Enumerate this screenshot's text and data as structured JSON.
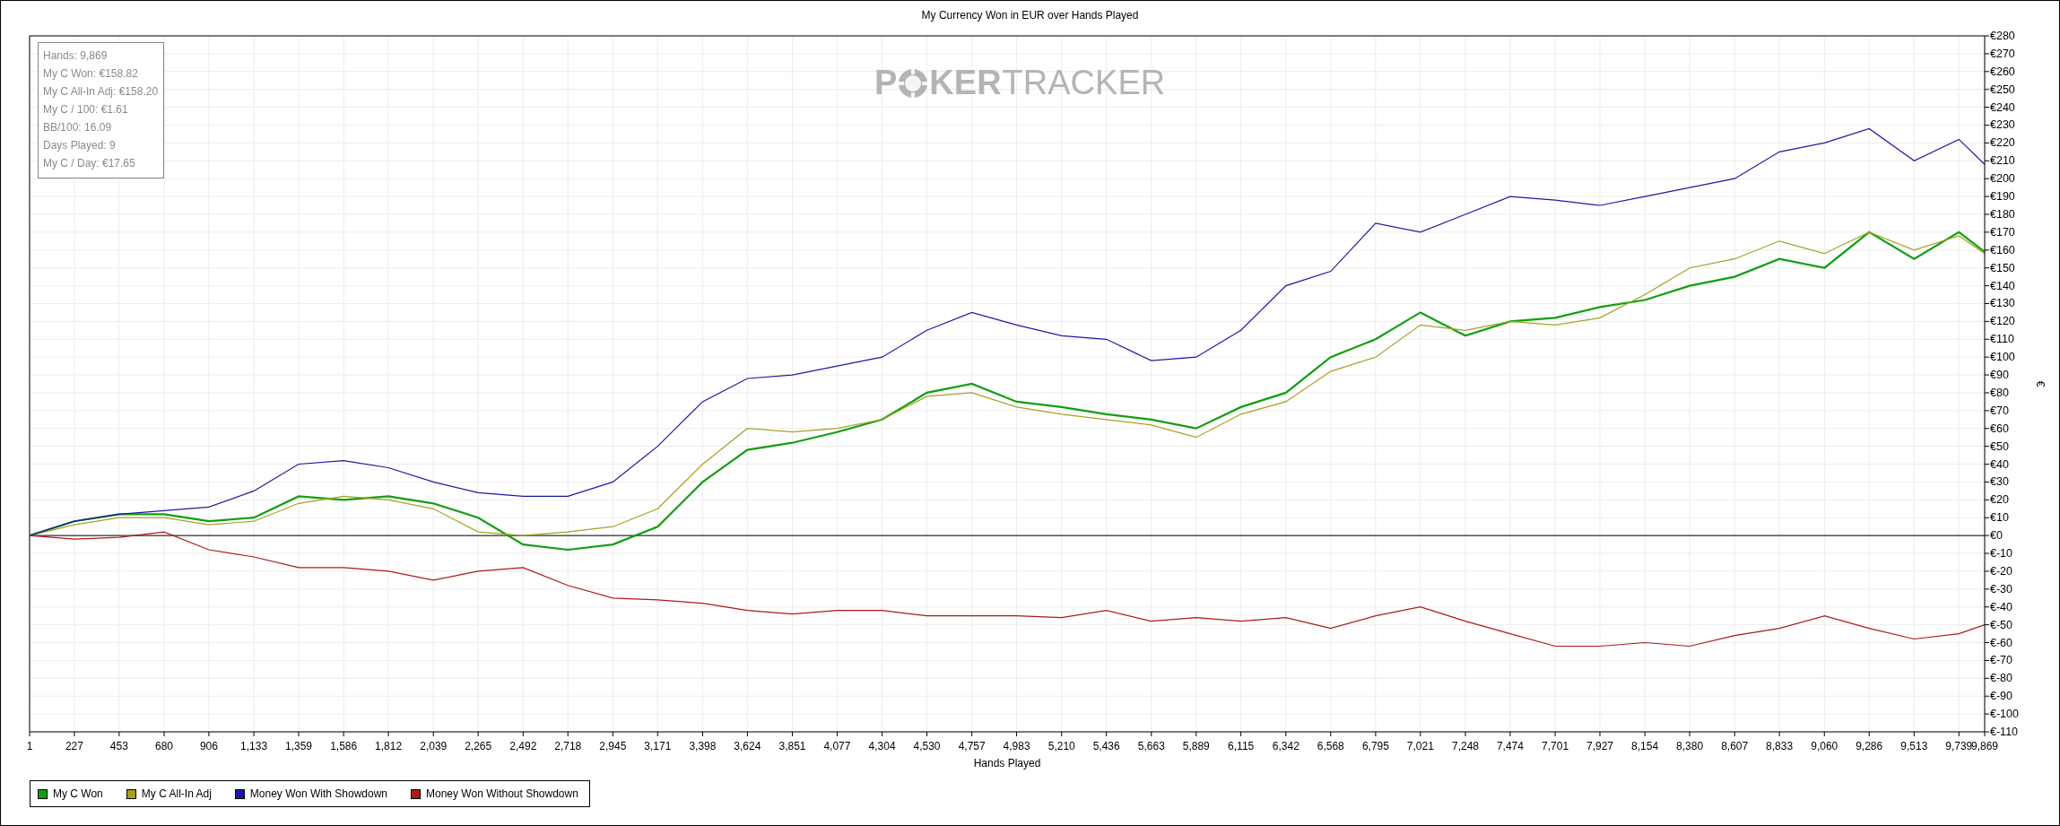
{
  "title": "My Currency Won in EUR over Hands Played",
  "stats_box": [
    "Hands: 9,869",
    "My C Won: €158.82",
    "My C All-In Adj: €158.20",
    "My C / 100: €1.61",
    "BB/100: 16.09",
    "Days Played: 9",
    "My C / Day: €17.65"
  ],
  "logo": {
    "first": "P",
    "middle": "KER",
    "last": "TRACKER"
  },
  "chart_data": {
    "type": "line",
    "xlabel": "Hands Played",
    "ylabel": "€",
    "ylim": [
      -110,
      280
    ],
    "xlim": [
      1,
      9869
    ],
    "grid": true,
    "x": [
      1,
      227,
      453,
      680,
      906,
      1133,
      1359,
      1586,
      1812,
      2039,
      2265,
      2492,
      2718,
      2945,
      3171,
      3398,
      3624,
      3851,
      4077,
      4304,
      4530,
      4757,
      4983,
      5210,
      5436,
      5663,
      5889,
      6115,
      6342,
      6568,
      6795,
      7021,
      7248,
      7474,
      7701,
      7927,
      8154,
      8380,
      8607,
      8833,
      9060,
      9286,
      9513,
      9739,
      9869
    ],
    "xticks": [
      {
        "value": 1,
        "label": "1"
      },
      {
        "value": 227,
        "label": "227"
      },
      {
        "value": 453,
        "label": "453"
      },
      {
        "value": 680,
        "label": "680"
      },
      {
        "value": 906,
        "label": "906"
      },
      {
        "value": 1133,
        "label": "1,133"
      },
      {
        "value": 1359,
        "label": "1,359"
      },
      {
        "value": 1586,
        "label": "1,586"
      },
      {
        "value": 1812,
        "label": "1,812"
      },
      {
        "value": 2039,
        "label": "2,039"
      },
      {
        "value": 2265,
        "label": "2,265"
      },
      {
        "value": 2492,
        "label": "2,492"
      },
      {
        "value": 2718,
        "label": "2,718"
      },
      {
        "value": 2945,
        "label": "2,945"
      },
      {
        "value": 3171,
        "label": "3,171"
      },
      {
        "value": 3398,
        "label": "3,398"
      },
      {
        "value": 3624,
        "label": "3,624"
      },
      {
        "value": 3851,
        "label": "3,851"
      },
      {
        "value": 4077,
        "label": "4,077"
      },
      {
        "value": 4304,
        "label": "4,304"
      },
      {
        "value": 4530,
        "label": "4,530"
      },
      {
        "value": 4757,
        "label": "4,757"
      },
      {
        "value": 4983,
        "label": "4,983"
      },
      {
        "value": 5210,
        "label": "5,210"
      },
      {
        "value": 5436,
        "label": "5,436"
      },
      {
        "value": 5663,
        "label": "5,663"
      },
      {
        "value": 5889,
        "label": "5,889"
      },
      {
        "value": 6115,
        "label": "6,115"
      },
      {
        "value": 6342,
        "label": "6,342"
      },
      {
        "value": 6568,
        "label": "6,568"
      },
      {
        "value": 6795,
        "label": "6,795"
      },
      {
        "value": 7021,
        "label": "7,021"
      },
      {
        "value": 7248,
        "label": "7,248"
      },
      {
        "value": 7474,
        "label": "7,474"
      },
      {
        "value": 7701,
        "label": "7,701"
      },
      {
        "value": 7927,
        "label": "7,927"
      },
      {
        "value": 8154,
        "label": "8,154"
      },
      {
        "value": 8380,
        "label": "8,380"
      },
      {
        "value": 8607,
        "label": "8,607"
      },
      {
        "value": 8833,
        "label": "8,833"
      },
      {
        "value": 9060,
        "label": "9,060"
      },
      {
        "value": 9286,
        "label": "9,286"
      },
      {
        "value": 9513,
        "label": "9,513"
      },
      {
        "value": 9739,
        "label": "9,739"
      },
      {
        "value": 9869,
        "label": "9,869"
      }
    ],
    "yticks": [
      {
        "value": -110,
        "label": "€-110"
      },
      {
        "value": -100,
        "label": "€-100"
      },
      {
        "value": -90,
        "label": "€-90"
      },
      {
        "value": -80,
        "label": "€-80"
      },
      {
        "value": -70,
        "label": "€-70"
      },
      {
        "value": -60,
        "label": "€-60"
      },
      {
        "value": -50,
        "label": "€-50"
      },
      {
        "value": -40,
        "label": "€-40"
      },
      {
        "value": -30,
        "label": "€-30"
      },
      {
        "value": -20,
        "label": "€-20"
      },
      {
        "value": -10,
        "label": "€-10"
      },
      {
        "value": 0,
        "label": "€0"
      },
      {
        "value": 10,
        "label": "€10"
      },
      {
        "value": 20,
        "label": "€20"
      },
      {
        "value": 30,
        "label": "€30"
      },
      {
        "value": 40,
        "label": "€40"
      },
      {
        "value": 50,
        "label": "€50"
      },
      {
        "value": 60,
        "label": "€60"
      },
      {
        "value": 70,
        "label": "€70"
      },
      {
        "value": 80,
        "label": "€80"
      },
      {
        "value": 90,
        "label": "€90"
      },
      {
        "value": 100,
        "label": "€100"
      },
      {
        "value": 110,
        "label": "€110"
      },
      {
        "value": 120,
        "label": "€120"
      },
      {
        "value": 130,
        "label": "€130"
      },
      {
        "value": 140,
        "label": "€140"
      },
      {
        "value": 150,
        "label": "€150"
      },
      {
        "value": 160,
        "label": "€160"
      },
      {
        "value": 170,
        "label": "€170"
      },
      {
        "value": 180,
        "label": "€180"
      },
      {
        "value": 190,
        "label": "€190"
      },
      {
        "value": 200,
        "label": "€200"
      },
      {
        "value": 210,
        "label": "€210"
      },
      {
        "value": 220,
        "label": "€220"
      },
      {
        "value": 230,
        "label": "€230"
      },
      {
        "value": 240,
        "label": "€240"
      },
      {
        "value": 250,
        "label": "€250"
      },
      {
        "value": 260,
        "label": "€260"
      },
      {
        "value": 270,
        "label": "€270"
      },
      {
        "value": 280,
        "label": "€280"
      }
    ],
    "series": [
      {
        "name": "My C Won",
        "color": "#10a010",
        "values": [
          0,
          8,
          12,
          12,
          8,
          10,
          22,
          20,
          22,
          18,
          10,
          -5,
          -8,
          -5,
          5,
          30,
          48,
          52,
          58,
          65,
          80,
          85,
          75,
          72,
          68,
          65,
          60,
          72,
          80,
          100,
          110,
          125,
          112,
          120,
          122,
          128,
          132,
          140,
          145,
          155,
          150,
          170,
          155,
          170,
          159
        ]
      },
      {
        "name": "My C All-In Adj",
        "color": "#a8a020",
        "values": [
          0,
          6,
          10,
          10,
          6,
          8,
          18,
          22,
          20,
          15,
          2,
          0,
          2,
          5,
          15,
          40,
          60,
          58,
          60,
          65,
          78,
          80,
          72,
          68,
          65,
          62,
          55,
          68,
          75,
          92,
          100,
          118,
          115,
          120,
          118,
          122,
          135,
          150,
          155,
          165,
          158,
          170,
          160,
          168,
          158
        ]
      },
      {
        "name": "Money Won With Showdown",
        "color": "#1a1aa8",
        "values": [
          0,
          8,
          12,
          14,
          16,
          25,
          40,
          42,
          38,
          30,
          24,
          22,
          22,
          30,
          50,
          75,
          88,
          90,
          95,
          100,
          115,
          125,
          118,
          112,
          110,
          98,
          100,
          115,
          140,
          148,
          175,
          170,
          180,
          190,
          188,
          185,
          190,
          195,
          200,
          215,
          220,
          228,
          210,
          222,
          208
        ]
      },
      {
        "name": "Money Won Without Showdown",
        "color": "#b01818",
        "values": [
          0,
          -2,
          -1,
          2,
          -8,
          -12,
          -18,
          -18,
          -20,
          -25,
          -20,
          -18,
          -28,
          -35,
          -36,
          -38,
          -42,
          -44,
          -42,
          -42,
          -45,
          -45,
          -45,
          -46,
          -42,
          -48,
          -46,
          -48,
          -46,
          -52,
          -45,
          -40,
          -48,
          -55,
          -62,
          -62,
          -60,
          -62,
          -56,
          -52,
          -45,
          -52,
          -58,
          -55,
          -50
        ]
      }
    ]
  }
}
